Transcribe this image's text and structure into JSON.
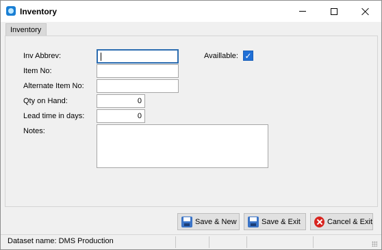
{
  "window": {
    "title": "Inventory",
    "icon": "app-gem-icon"
  },
  "titlebar_buttons": {
    "minimize": "minimize-icon",
    "maximize": "maximize-icon",
    "close": "close-icon"
  },
  "tab": {
    "label": "Inventory"
  },
  "form": {
    "inv_abbrev": {
      "label": "Inv Abbrev:",
      "value": ""
    },
    "item_no": {
      "label": "Item No:",
      "value": ""
    },
    "alternate_item_no": {
      "label": "Alternate Item No:",
      "value": ""
    },
    "qty_on_hand": {
      "label": "Qty on Hand:",
      "value": "0"
    },
    "lead_time": {
      "label": "Lead time in days:",
      "value": "0"
    },
    "notes": {
      "label": "Notes:",
      "value": ""
    },
    "available": {
      "label": "Availlable:",
      "checked": true
    }
  },
  "buttons": {
    "save_new": "Save & New",
    "save_exit": "Save & Exit",
    "cancel_exit": "Cancel & Exit"
  },
  "status": {
    "dataset": "Dataset name:  DMS Production"
  },
  "colors": {
    "accent": "#1f6fd6",
    "cancel": "#d8241f"
  }
}
